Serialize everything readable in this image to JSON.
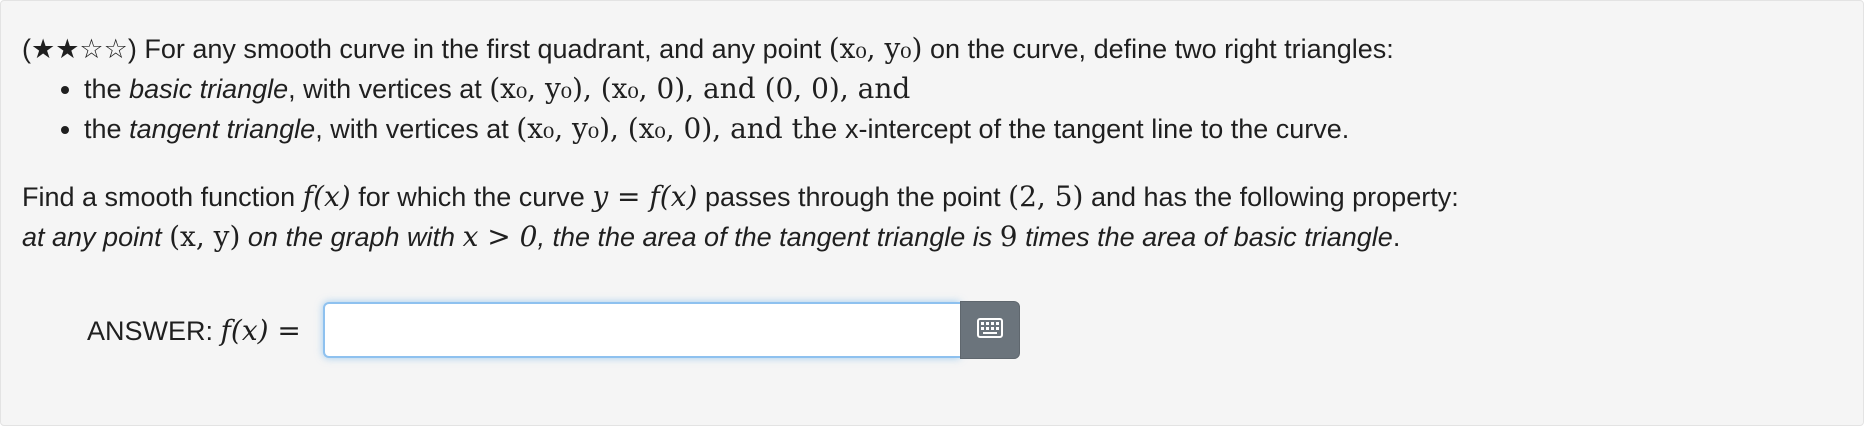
{
  "problem": {
    "rating": "★★☆☆",
    "intro_prefix": "For any smooth curve in the first quadrant, and any point",
    "point_x0y0": "(x₀, y₀)",
    "intro_suffix": "on the curve, define two right triangles:",
    "bullets": [
      {
        "pre": "the",
        "term": "basic triangle",
        "mid": ", with vertices at",
        "pts": "(x₀, y₀), (x₀, 0), and (0, 0), and",
        "tail": ""
      },
      {
        "pre": "the",
        "term": "tangent triangle",
        "mid": ", with vertices at",
        "pts": "(x₀, y₀), (x₀, 0), and the",
        "tail": "x-intercept of the tangent line to the curve."
      }
    ],
    "find_a": "Find a smooth function",
    "fx": "f(x)",
    "find_b": "for which the curve",
    "eq": "y = f(x)",
    "find_c": "passes through the point",
    "point": "(2, 5)",
    "find_d": "and has the following property:",
    "prop_a": "at any point",
    "xy": "(x, y)",
    "prop_b": "on the graph with",
    "cond": "x > 0",
    "prop_c": ", the the area of the tangent triangle is",
    "nine": "9",
    "prop_d": "times the area of basic triangle",
    "period": "."
  },
  "answer": {
    "label": "ANSWER:",
    "lhs": "f(x) =",
    "value": "",
    "placeholder": "",
    "keyboard_icon": "keyboard-icon"
  },
  "colors": {
    "panel_bg": "#f5f5f5",
    "focus_border": "#8ec1ef",
    "button_bg": "#6b747c"
  }
}
